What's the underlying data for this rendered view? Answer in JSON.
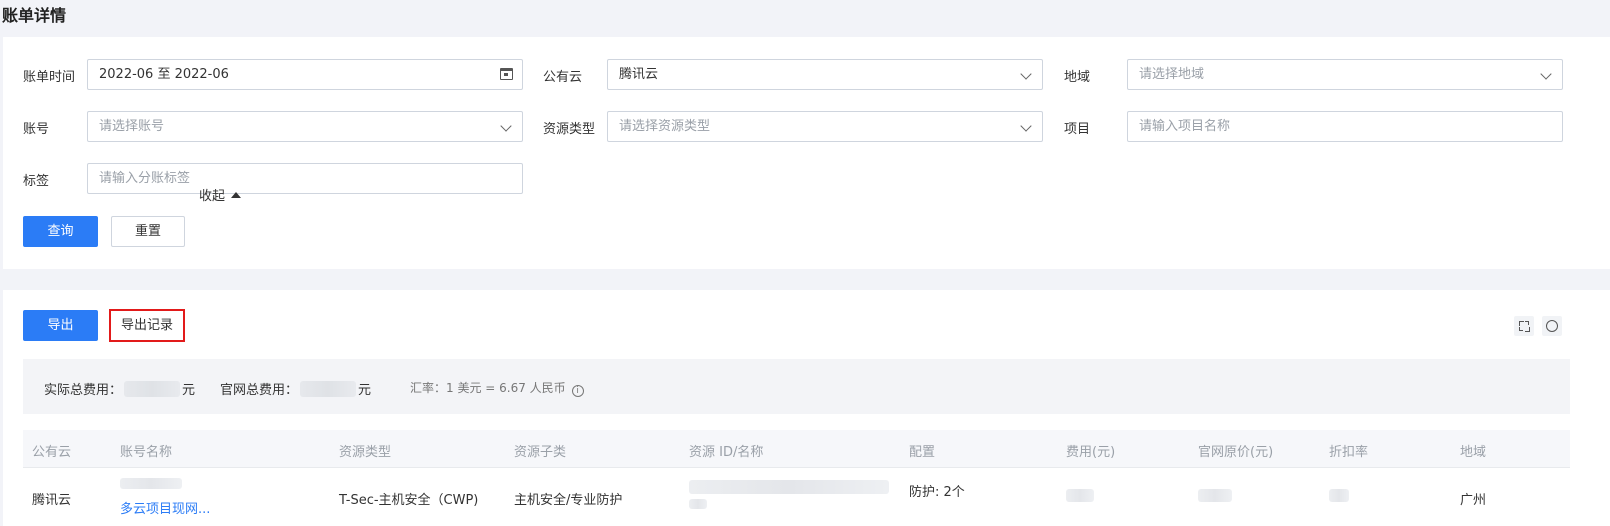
{
  "page": {
    "title": "账单详情"
  },
  "filters": {
    "bill_time": {
      "label": "账单时间",
      "value": "2022-06 至 2022-06"
    },
    "public_cloud": {
      "label": "公有云",
      "value": "腾讯云"
    },
    "region": {
      "label": "地域",
      "placeholder": "请选择地域"
    },
    "account": {
      "label": "账号",
      "placeholder": "请选择账号"
    },
    "resource_type": {
      "label": "资源类型",
      "placeholder": "请选择资源类型"
    },
    "project": {
      "label": "项目",
      "placeholder": "请输入项目名称"
    },
    "tag": {
      "label": "标签",
      "placeholder": "请输入分账标签"
    }
  },
  "actions": {
    "query": "查询",
    "reset": "重置",
    "collapse": "收起"
  },
  "toolbar": {
    "export": "导出",
    "export_record": "导出记录"
  },
  "summary": {
    "actual_total_label": "实际总费用：",
    "official_total_label": "官网总费用：",
    "currency_unit": "元",
    "exchange_rate": "汇率：1 美元 = 6.67 人民币"
  },
  "table": {
    "columns": [
      "公有云",
      "账号名称",
      "资源类型",
      "资源子类",
      "资源 ID/名称",
      "配置",
      "费用(元)",
      "官网原价(元)",
      "折扣率",
      "地域"
    ],
    "rows": [
      {
        "cloud": "腾讯云",
        "account_link": "多云项目现网...",
        "resource_type": "T-Sec-主机安全（CWP)",
        "resource_subtype": "主机安全/专业防护",
        "config": "防护: 2个",
        "region": "广州"
      }
    ]
  },
  "colors": {
    "primary": "#2b7cf6",
    "highlight_border": "#e21a1a",
    "background": "#f2f3f8"
  }
}
